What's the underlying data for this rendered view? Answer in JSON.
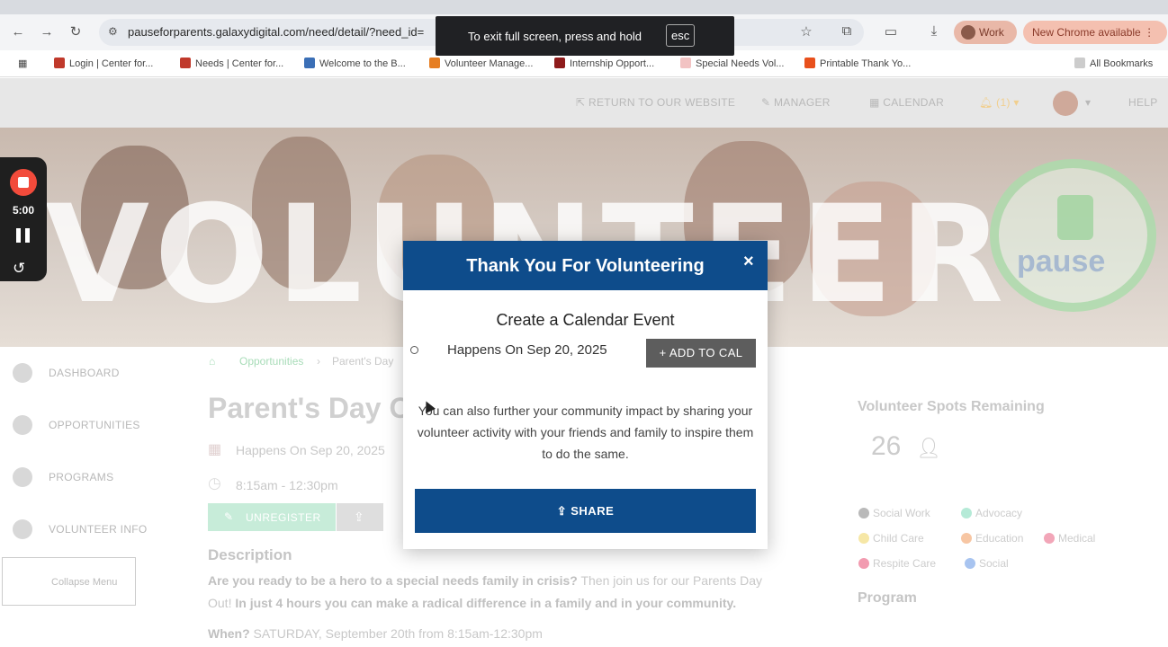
{
  "browser": {
    "url": "pauseforparents.galaxydigital.com/need/detail/?need_id=",
    "profile_label": "Work",
    "update_label": "New Chrome available",
    "bookmarks": [
      {
        "label": "Login | Center for...",
        "color": "#c0392b"
      },
      {
        "label": "Needs | Center for...",
        "color": "#c0392b"
      },
      {
        "label": "Welcome to the B...",
        "color": "#3b6fb6"
      },
      {
        "label": "Volunteer Manage...",
        "color": "#e67e22"
      },
      {
        "label": "Internship Opport...",
        "color": "#8e1b1b"
      },
      {
        "label": "Special Needs Vol...",
        "color": "#f2c3c3"
      },
      {
        "label": "Printable Thank Yo...",
        "color": "#e8501c"
      }
    ],
    "all_bookmarks_label": "All Bookmarks"
  },
  "fullscreen_toast": {
    "text": "To exit full screen, press and hold",
    "key": "esc"
  },
  "site_nav": {
    "return_label": "RETURN TO OUR WEBSITE",
    "manager_label": "MANAGER",
    "calendar_label": "CALENDAR",
    "alerts_label": "(1)",
    "help_label": "HELP"
  },
  "hero": {
    "word": "VOLUNTEER",
    "logo_word": "pause"
  },
  "recorder": {
    "time": "5:00"
  },
  "sidebar": {
    "items": [
      {
        "label": "DASHBOARD"
      },
      {
        "label": "OPPORTUNITIES"
      },
      {
        "label": "PROGRAMS"
      },
      {
        "label": "VOLUNTEER INFO"
      }
    ],
    "collapse_label": "Collapse Menu"
  },
  "main": {
    "breadcrumb_1": "Opportunities",
    "breadcrumb_2": "Parent's Day",
    "title": "Parent's Day O",
    "date": "Happens On Sep 20, 2025",
    "time": "8:15am - 12:30pm",
    "unregister_label": "UNREGISTER",
    "description_heading": "Description",
    "desc_bold_1": "Are you ready to be a hero to a special needs family in crisis?",
    "desc_normal_1": " Then join us for our Parents Day",
    "desc_normal_2": "Out!",
    "desc_bold_2": " In just 4 hours you can make a radical difference in a family and in your community.",
    "when_label": "When?",
    "when_value": " SATURDAY, September 20th from 8:15am-12:30pm"
  },
  "right": {
    "spots_label": "Volunteer Spots Remaining",
    "spots_value": "26",
    "tags": [
      {
        "label": "Social Work",
        "color": "#b9b9b9"
      },
      {
        "label": "Advocacy",
        "color": "#b5ead7"
      },
      {
        "label": "Child Care",
        "color": "#f6e7a6"
      },
      {
        "label": "Education",
        "color": "#f7c6a3"
      },
      {
        "label": "Medical",
        "color": "#f2a6b8"
      },
      {
        "label": "Respite Care",
        "color": "#f29bb0"
      },
      {
        "label": "Social",
        "color": "#a8c4f0"
      }
    ],
    "program_label": "Program"
  },
  "modal": {
    "title": "Thank You For Volunteering",
    "calendar_heading": "Create a Calendar Event",
    "happens": "Happens On Sep 20, 2025",
    "add_to_cal_label": "+ ADD TO CAL",
    "impact_text": "You can also further your community impact by sharing your volunteer activity with your friends and family to inspire them to do the same.",
    "share_label": "SHARE",
    "accent": "#0e4c8b"
  }
}
